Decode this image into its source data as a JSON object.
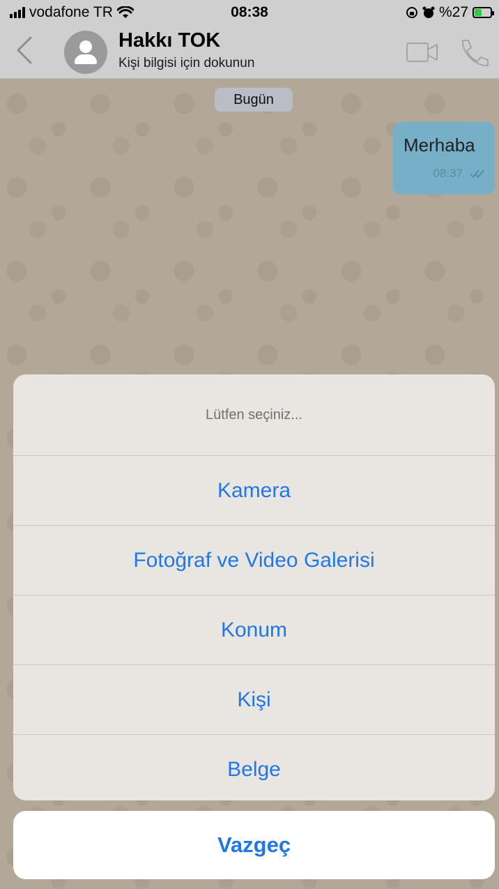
{
  "status_bar": {
    "carrier": "vodafone TR",
    "time": "08:38",
    "battery": "%27"
  },
  "header": {
    "contact_name": "Hakkı TOK",
    "subtitle": "Kişi bilgisi için dokunun"
  },
  "chat": {
    "date_label": "Bugün",
    "messages": [
      {
        "text": "Merhaba",
        "time": "08:37"
      }
    ]
  },
  "action_sheet": {
    "title": "Lütfen seçiniz...",
    "options": [
      "Kamera",
      "Fotoğraf ve Video Galerisi",
      "Konum",
      "Kişi",
      "Belge"
    ],
    "cancel": "Vazgeç"
  },
  "colors": {
    "accent": "#1f78e6",
    "bubble": "#77afc9",
    "wallpaper": "#b3a897"
  }
}
